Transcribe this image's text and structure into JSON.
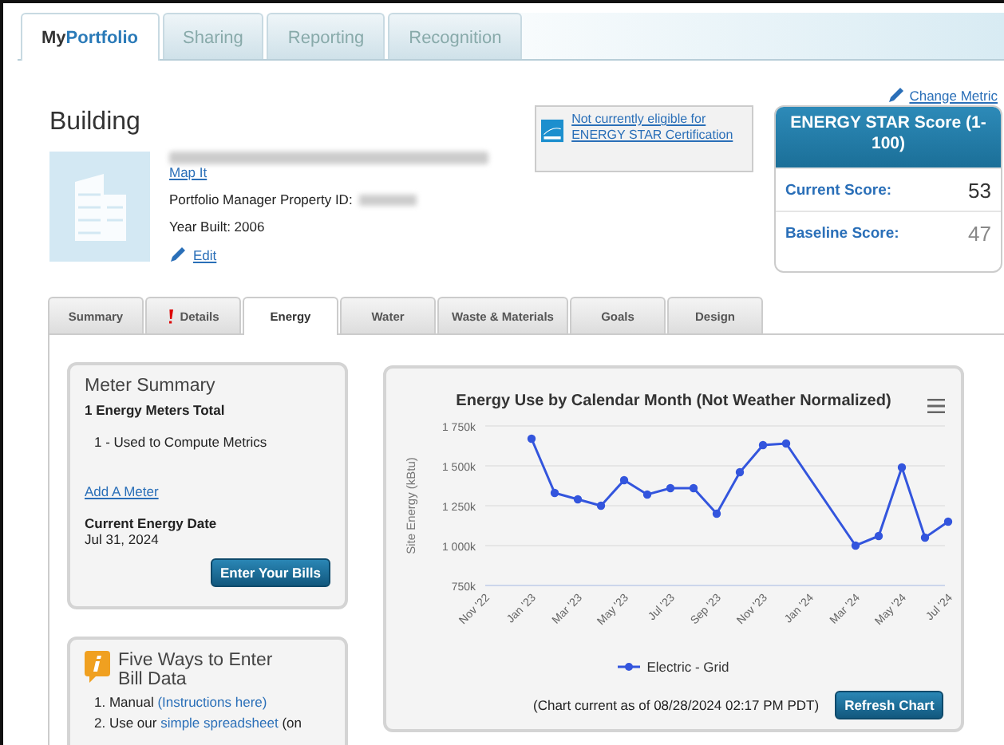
{
  "top_tabs": [
    {
      "label": "My",
      "label_accent": "Portfolio",
      "selected": true
    },
    {
      "label": "Sharing",
      "selected": false
    },
    {
      "label": "Reporting",
      "selected": false
    },
    {
      "label": "Recognition",
      "selected": false
    }
  ],
  "change_metric": "Change Metric",
  "building": {
    "title": "Building",
    "map_link": "Map It",
    "property_id_label": "Portfolio Manager Property ID:",
    "year_built": "Year Built: 2006",
    "edit": "Edit"
  },
  "certification": "Not currently eligible for ENERGY STAR Certification",
  "score_card": {
    "title": "ENERGY STAR Score (1-100)",
    "rows": [
      {
        "label": "Current Score:",
        "value": "53"
      },
      {
        "label": "Baseline Score:",
        "value": "47"
      }
    ]
  },
  "inner_tabs": [
    {
      "label": "Summary",
      "selected": false,
      "alert": false
    },
    {
      "label": "Details",
      "selected": false,
      "alert": true
    },
    {
      "label": "Energy",
      "selected": true,
      "alert": false
    },
    {
      "label": "Water",
      "selected": false,
      "alert": false
    },
    {
      "label": "Waste & Materials",
      "selected": false,
      "alert": false
    },
    {
      "label": "Goals",
      "selected": false,
      "alert": false
    },
    {
      "label": "Design",
      "selected": false,
      "alert": false
    }
  ],
  "meter_summary": {
    "title": "Meter Summary",
    "total": "1 Energy Meters Total",
    "used": "1 - Used to Compute Metrics",
    "add_link": "Add A Meter",
    "date_label": "Current Energy Date",
    "date": "Jul 31, 2024",
    "button": "Enter Your Bills"
  },
  "five_ways": {
    "title": "Five Ways to Enter Bill Data",
    "items": [
      {
        "text": "1. Manual",
        "link": "(Instructions here)"
      },
      {
        "text": "2. Use our",
        "link": "simple spreadsheet",
        "after": "(on"
      }
    ]
  },
  "chart_panel": {
    "footer": "(Chart current as of  08/28/2024 02:17 PM PDT)",
    "button": "Refresh Chart",
    "chart_data": {
      "type": "line",
      "title": "Energy Use by Calendar Month (Not Weather Normalized)",
      "ylabel": "Site Energy (kBtu)",
      "categories": [
        "Nov '22",
        null,
        "Jan '23",
        null,
        "Mar '23",
        null,
        "May '23",
        null,
        "Jul '23",
        null,
        "Sep '23",
        null,
        "Nov '23",
        null,
        "Jan '24",
        null,
        "Mar '24",
        null,
        "May '24",
        null,
        "Jul '24"
      ],
      "grid": true,
      "series": [
        {
          "name": "Electric - Grid",
          "color": "#3355dd",
          "marker": true,
          "values": [
            null,
            null,
            1670,
            1330,
            1290,
            1250,
            1410,
            1320,
            1360,
            1360,
            1200,
            1460,
            1630,
            1640,
            null,
            null,
            1000,
            1060,
            1490,
            1050,
            1150
          ]
        }
      ],
      "ylim": [
        750,
        1750
      ],
      "yticks": [
        {
          "value": 750,
          "label": "750k"
        },
        {
          "value": 1000,
          "label": "1 000k"
        },
        {
          "value": 1250,
          "label": "1 250k"
        },
        {
          "value": 1500,
          "label": "1 500k"
        },
        {
          "value": 1750,
          "label": "1 750k"
        }
      ]
    }
  }
}
